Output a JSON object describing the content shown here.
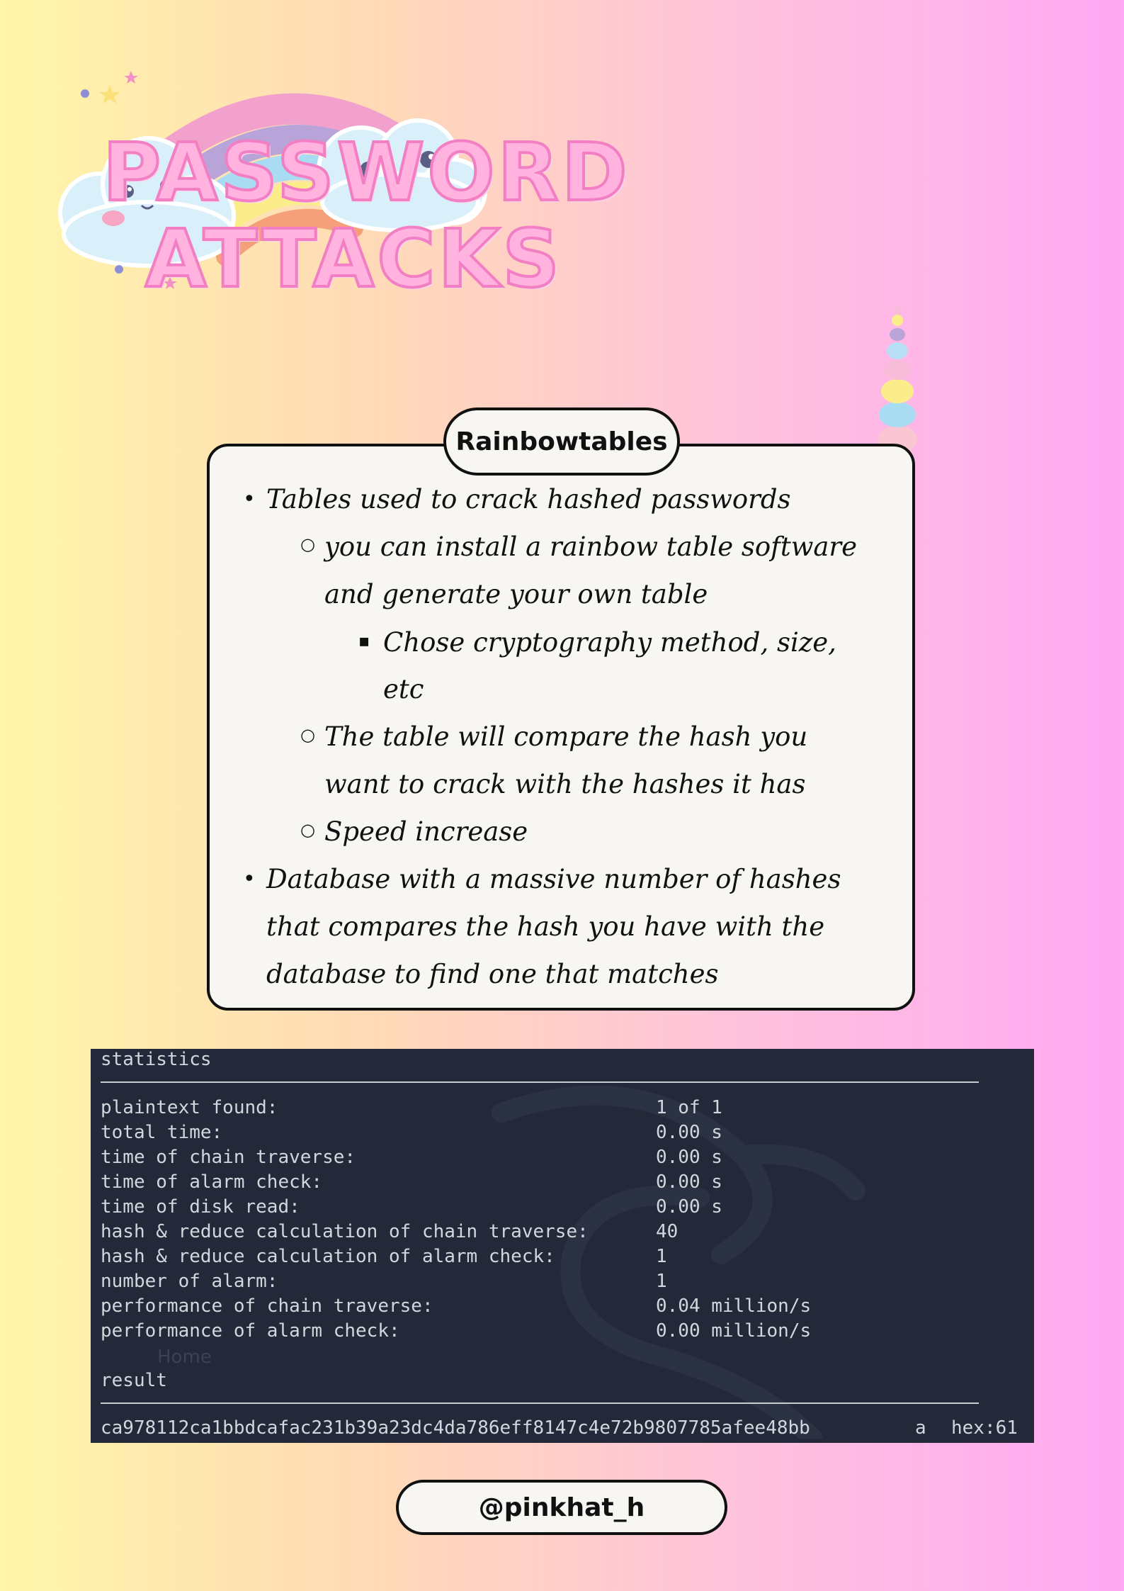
{
  "title": {
    "line1": "PASSWORD",
    "line2": "ATTACKS"
  },
  "card": {
    "heading": "Rainbowtables",
    "notes": [
      "Tables used to crack hashed passwords",
      "you can install a rainbow table software",
      "and generate your own table",
      "Chose cryptography method, size,",
      "etc",
      "The table will compare the hash you",
      "want to crack with the hashes it has",
      "Speed increase",
      "Database with a massive number of hashes",
      "that compares the hash you have with the",
      "database to find one that matches"
    ],
    "bullets": {
      "level1": "•",
      "level2": "○",
      "level3": "▪"
    }
  },
  "terminal": {
    "header": "statistics",
    "rows": [
      {
        "label": "plaintext found:",
        "value": "1 of 1"
      },
      {
        "label": "total time:",
        "value": "0.00 s"
      },
      {
        "label": "time of chain traverse:",
        "value": "0.00 s"
      },
      {
        "label": "time of alarm check:",
        "value": "0.00 s"
      },
      {
        "label": "time of disk read:",
        "value": "0.00 s"
      },
      {
        "label": "hash & reduce calculation of chain traverse:",
        "value": "40"
      },
      {
        "label": "hash & reduce calculation of alarm check:",
        "value": "1"
      },
      {
        "label": "number of alarm:",
        "value": "1"
      },
      {
        "label": "performance of chain traverse:",
        "value": "0.04 million/s"
      },
      {
        "label": "performance of alarm check:",
        "value": "0.00 million/s"
      }
    ],
    "background_text": "Home",
    "result_header": "result",
    "result": {
      "hash": "ca978112ca1bbdcafac231b39a23dc4da786eff8147c4e72b9807785afee48bb",
      "plaintext": "a",
      "hex": "hex:61"
    }
  },
  "handle": "@pinkhat_h",
  "colors": {
    "title_fill": "#ffb3de",
    "title_outline": "#f27fc4",
    "card_bg": "#f7f6f3",
    "terminal_bg": "#232938",
    "terminal_text": "#d3d6dc"
  }
}
